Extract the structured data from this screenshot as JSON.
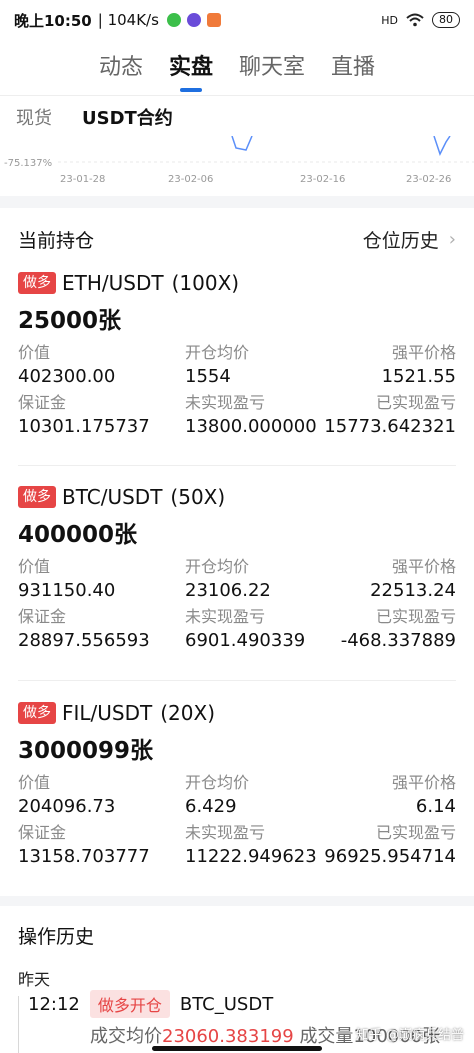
{
  "status_bar": {
    "time": "晚上10:50",
    "network_speed": "| 104K/s",
    "signal": "HD",
    "battery": "80"
  },
  "top_tabs": [
    {
      "label": "动态",
      "active": false
    },
    {
      "label": "实盘",
      "active": true
    },
    {
      "label": "聊天室",
      "active": false
    },
    {
      "label": "直播",
      "active": false
    }
  ],
  "sub_tabs": [
    {
      "label": "现货",
      "active": false
    },
    {
      "label": "USDT合约",
      "active": true
    }
  ],
  "chart_data": {
    "type": "line",
    "y_tick_label": "-75.137%",
    "x_ticks": [
      "23-01-28",
      "23-02-06",
      "23-02-16",
      "23-02-26"
    ],
    "series_color": "#5b8ff9"
  },
  "positions_section": {
    "title": "当前持仓",
    "history_link": "仓位历史"
  },
  "positions": [
    {
      "side": "做多",
      "symbol": "ETH/USDT",
      "leverage": "(100X)",
      "quantity": "25000张",
      "labels": [
        "价值",
        "开仓均价",
        "强平价格",
        "保证金",
        "未实现盈亏",
        "已实现盈亏"
      ],
      "value": "402300.00",
      "entry_price": "1554",
      "liq_price": "1521.55",
      "margin": "10301.175737",
      "unrealized_pnl": "13800.000000",
      "realized_pnl": "15773.642321"
    },
    {
      "side": "做多",
      "symbol": "BTC/USDT",
      "leverage": "(50X)",
      "quantity": "400000张",
      "labels": [
        "价值",
        "开仓均价",
        "强平价格",
        "保证金",
        "未实现盈亏",
        "已实现盈亏"
      ],
      "value": "931150.40",
      "entry_price": "23106.22",
      "liq_price": "22513.24",
      "margin": "28897.556593",
      "unrealized_pnl": "6901.490339",
      "realized_pnl": "-468.337889"
    },
    {
      "side": "做多",
      "symbol": "FIL/USDT",
      "leverage": "(20X)",
      "quantity": "3000099张",
      "labels": [
        "价值",
        "开仓均价",
        "强平价格",
        "保证金",
        "未实现盈亏",
        "已实现盈亏"
      ],
      "value": "204096.73",
      "entry_price": "6.429",
      "liq_price": "6.14",
      "margin": "13158.703777",
      "unrealized_pnl": "11222.949623",
      "realized_pnl": "96925.954714"
    }
  ],
  "history": {
    "title": "操作历史",
    "day": "昨天",
    "entries": [
      {
        "time": "12:12",
        "action": "做多开仓",
        "symbol": "BTC_USDT",
        "detail_prefix": "成交均价",
        "detail_price": "23060.383199",
        "detail_suffix": "成交量100000张"
      }
    ]
  },
  "watermark": "知乎 @巅痫兵结普"
}
